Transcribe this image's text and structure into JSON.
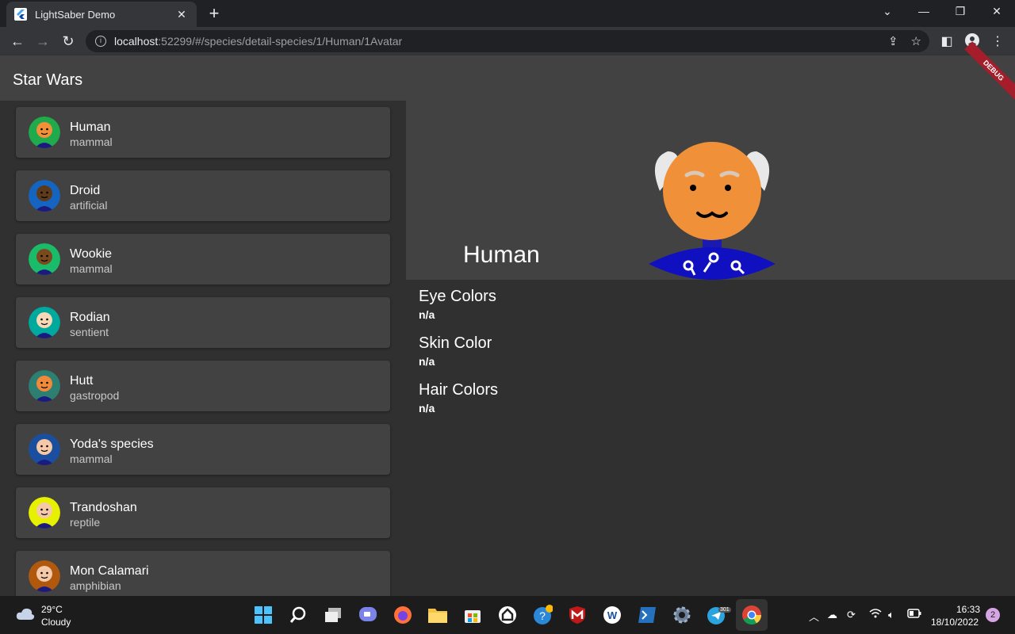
{
  "browser": {
    "tab_title": "LightSaber Demo",
    "url_host": "localhost",
    "url_rest": ":52299/#/species/detail-species/1/Human/1Avatar"
  },
  "app": {
    "title": "Star Wars",
    "debug_label": "DEBUG"
  },
  "species": [
    {
      "name": "Human",
      "classification": "mammal",
      "bg": "#1faa4b",
      "skin": "#f0913a"
    },
    {
      "name": "Droid",
      "classification": "artificial",
      "bg": "#1565c0",
      "skin": "#5d3a1a"
    },
    {
      "name": "Wookie",
      "classification": "mammal",
      "bg": "#1abc6a",
      "skin": "#7a4a1e"
    },
    {
      "name": "Rodian",
      "classification": "sentient",
      "bg": "#00a99d",
      "skin": "#f5d8b5"
    },
    {
      "name": "Hutt",
      "classification": "gastropod",
      "bg": "#2d7f72",
      "skin": "#f08a3a"
    },
    {
      "name": "Yoda's species",
      "classification": "mammal",
      "bg": "#1a4fa0",
      "skin": "#f5c8a8"
    },
    {
      "name": "Trandoshan",
      "classification": "reptile",
      "bg": "#e6f000",
      "skin": "#f5c8a8"
    },
    {
      "name": "Mon Calamari",
      "classification": "amphibian",
      "bg": "#b0580e",
      "skin": "#f5c8a8"
    }
  ],
  "detail": {
    "title": "Human",
    "fields": [
      {
        "label": "Eye Colors",
        "value": "n/a"
      },
      {
        "label": "Skin Color",
        "value": "n/a"
      },
      {
        "label": "Hair Colors",
        "value": "n/a"
      }
    ]
  },
  "taskbar": {
    "temp": "29°C",
    "condition": "Cloudy",
    "time": "16:33",
    "date": "18/10/2022",
    "notifications": "2",
    "telegram_badge": "301"
  }
}
